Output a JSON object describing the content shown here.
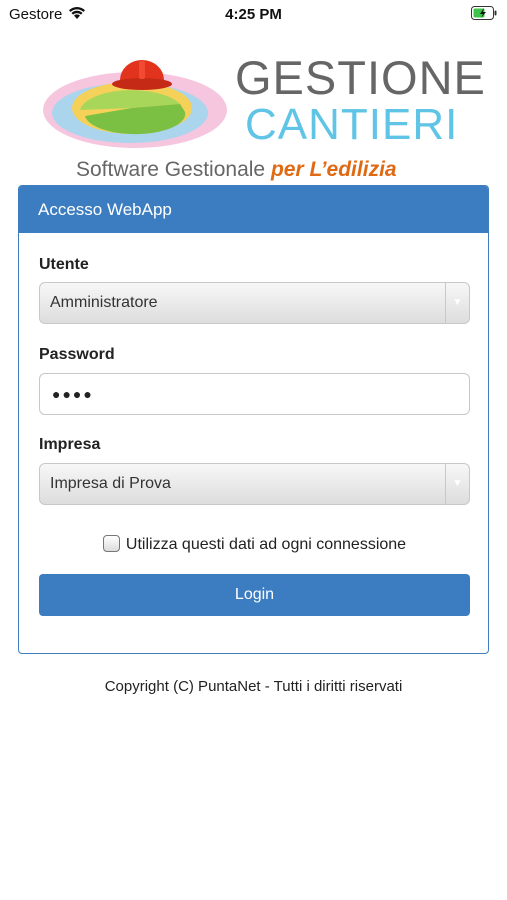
{
  "status_bar": {
    "carrier": "Gestore",
    "time": "4:25 PM",
    "wifi_icon": "wifi-icon",
    "battery_icon": "battery-charging-icon"
  },
  "logo": {
    "title_line1": "GESTIONE",
    "title_line2": "CANTIERI",
    "subtitle_prefix": "Software Gestionale ",
    "subtitle_accent": "per L’edilizia"
  },
  "login_panel": {
    "header": "Accesso WebApp",
    "user_label": "Utente",
    "user_value": "Amministratore",
    "password_label": "Password",
    "password_value": "●●●●",
    "company_label": "Impresa",
    "company_value": "Impresa di Prova",
    "remember_label": "Utilizza questi dati ad ogni connessione",
    "login_button": "Login"
  },
  "footer": {
    "copyright": "Copyright (C) PuntaNet - Tutti i diritti riservati"
  },
  "colors": {
    "accent": "#3b7dc0",
    "logo_blue": "#5fc4e6",
    "logo_orange": "#e06a14"
  }
}
